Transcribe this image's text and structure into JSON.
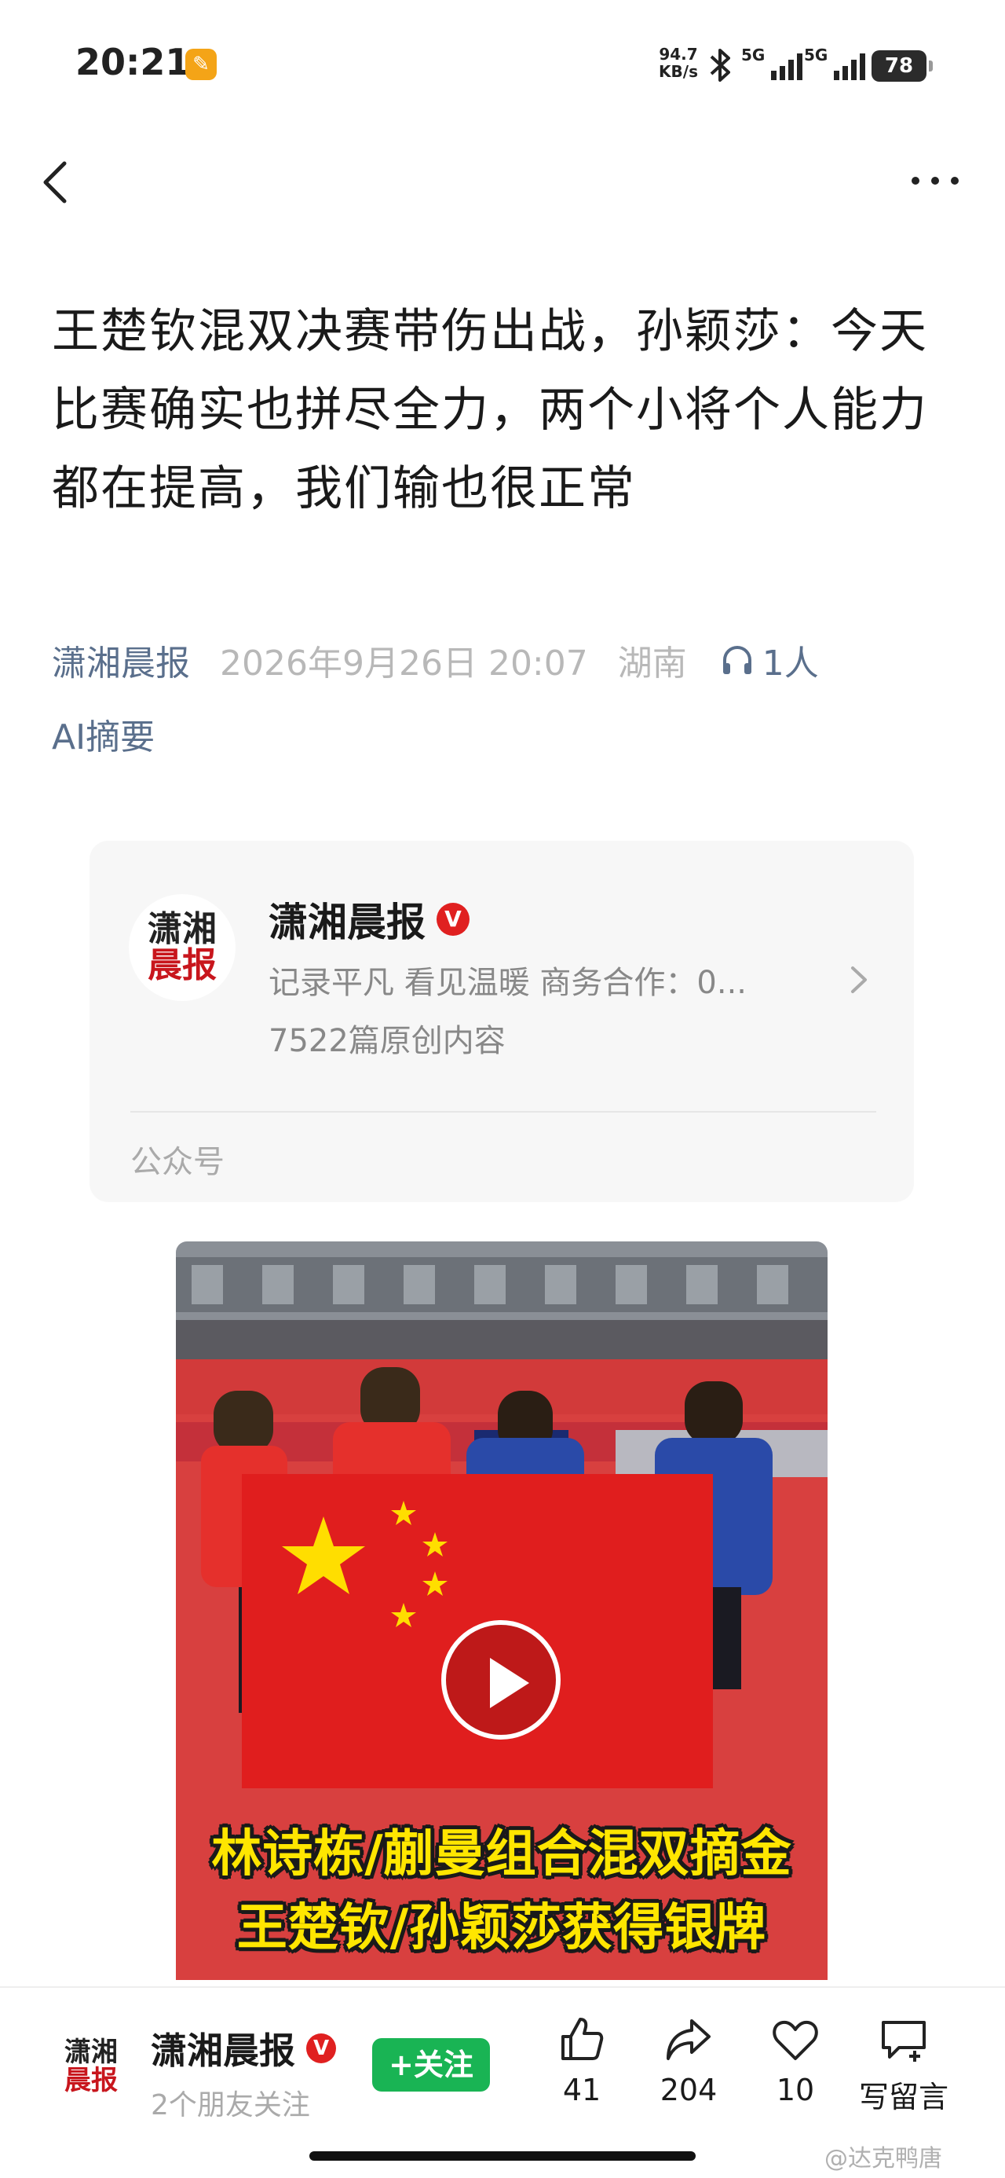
{
  "status_bar": {
    "time": "20:21",
    "net_speed_value": "94.7",
    "net_speed_unit": "KB/s",
    "signal1_label": "5G",
    "signal2_label": "5G",
    "battery": "78"
  },
  "article": {
    "title": "王楚钦混双决赛带伤出战，孙颖莎：今天比赛确实也拼尽全力，两个小将个人能力都在提高，我们输也很正常",
    "source": "潇湘晨报",
    "date": "2026年9月26日 20:07",
    "region": "湖南",
    "listeners": "1人",
    "ai_summary": "AI摘要"
  },
  "account_card": {
    "logo_line1": "潇湘",
    "logo_line2": "晨报",
    "name": "潇湘晨报",
    "verified_badge": "V",
    "description": "记录平凡 看见温暖 商务合作：0...",
    "original_count": "7522篇原创内容",
    "type": "公众号"
  },
  "video": {
    "caption_line1": "林诗栋/蒯曼组合混双摘金",
    "caption_line2": "王楚钦/孙颖莎获得银牌"
  },
  "bottom_bar": {
    "name": "潇湘晨报",
    "verified_badge": "V",
    "friends_following": "2个朋友关注",
    "follow_label": "+关注",
    "like_count": "41",
    "share_count": "204",
    "favorite_count": "10",
    "comment_label": "写留言"
  },
  "watermark": "@达克鸭唐",
  "colors": {
    "source_blue": "#5a6f8c",
    "follow_green": "#19b454",
    "verified_red": "#e02020",
    "caption_yellow": "#ffe600"
  }
}
